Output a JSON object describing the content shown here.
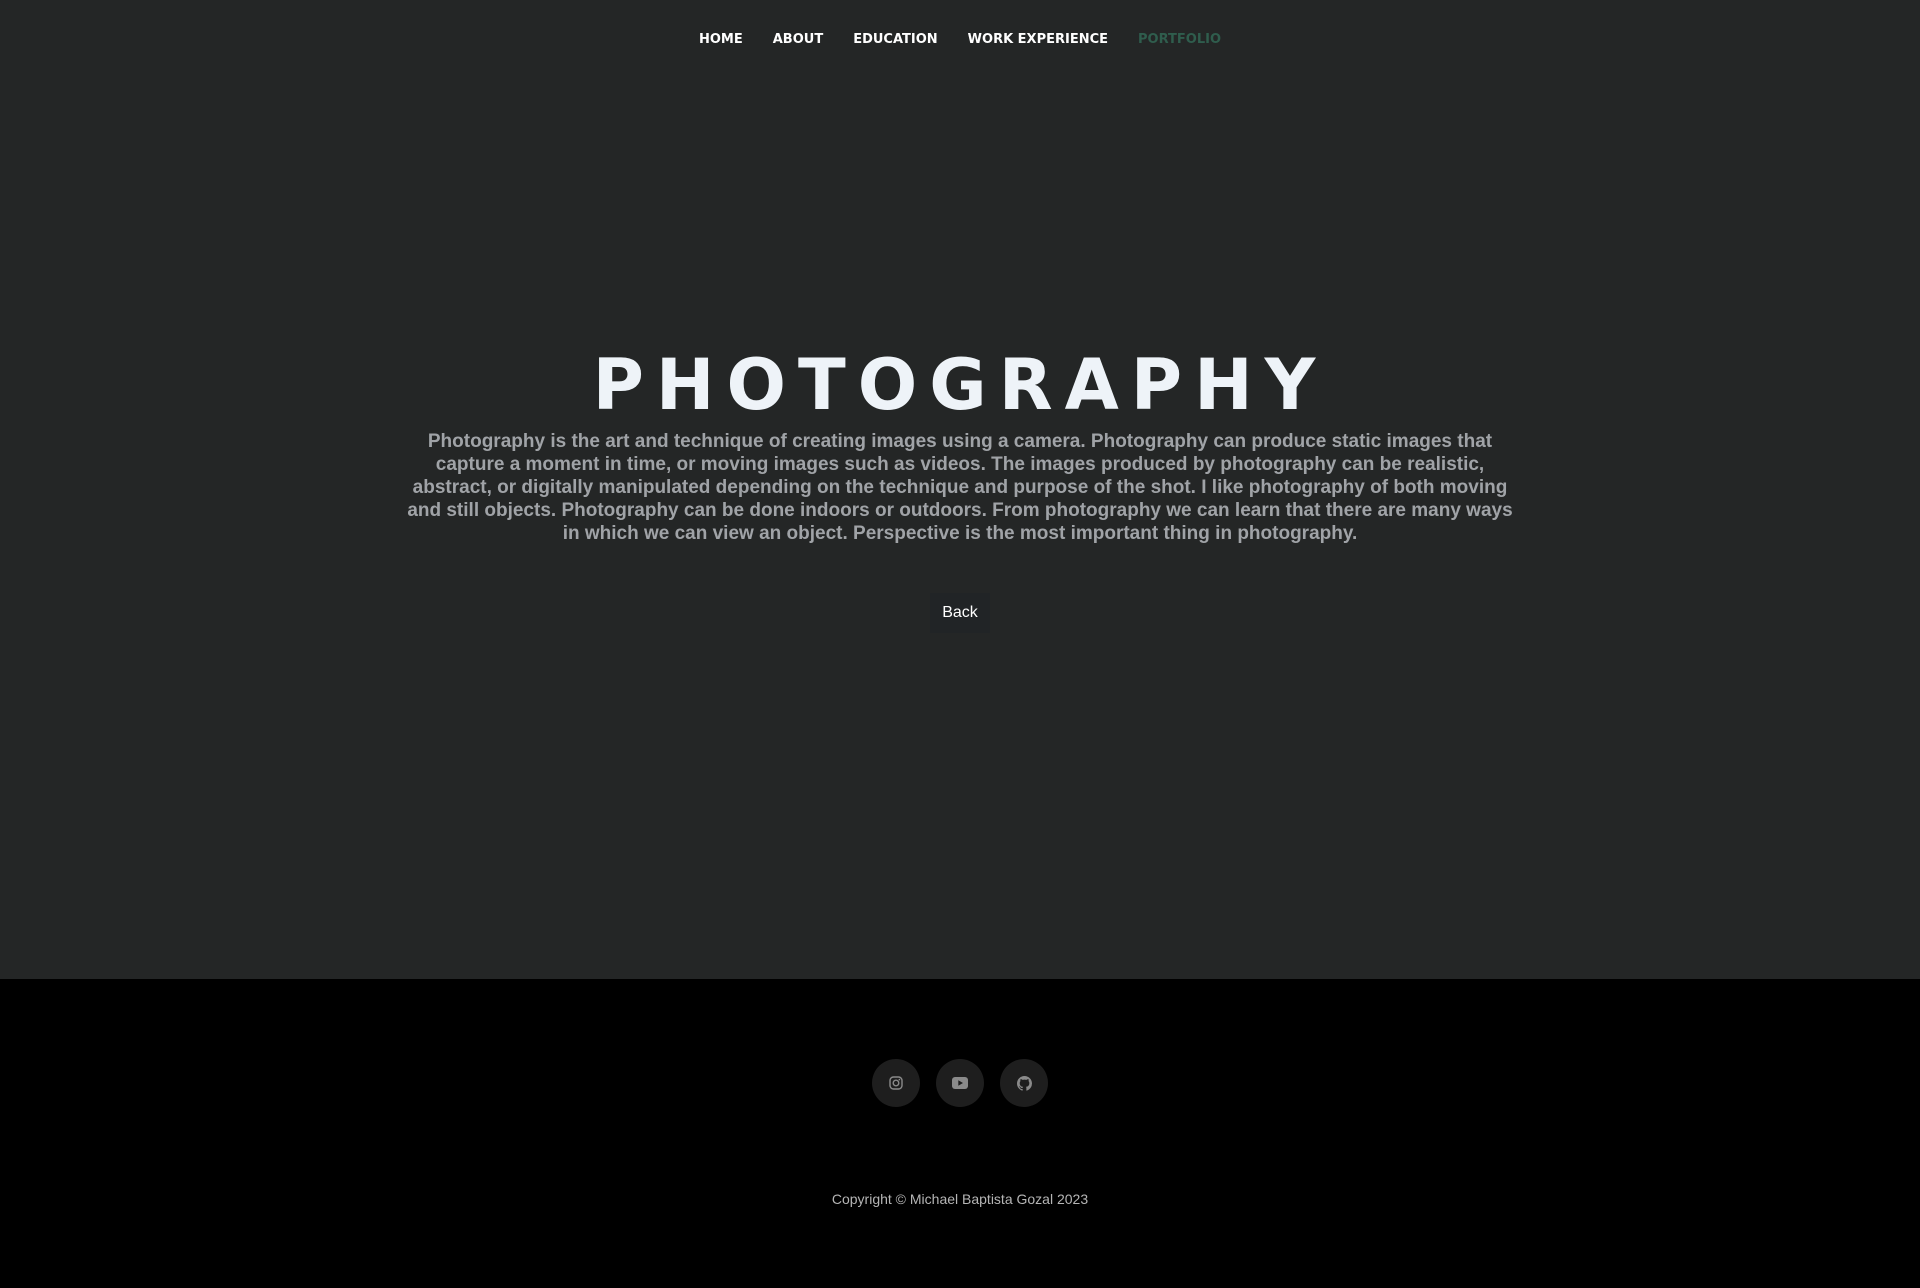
{
  "nav": {
    "items": [
      {
        "label": "HOME"
      },
      {
        "label": "ABOUT"
      },
      {
        "label": "EDUCATION"
      },
      {
        "label": "WORK EXPERIENCE"
      },
      {
        "label": "PORTFOLIO",
        "active": true
      }
    ]
  },
  "hero": {
    "title": "PHOTOGRAPHY",
    "description": "Photography is the art and technique of creating images using a camera. Photography can produce static images that capture a moment in time, or moving images such as videos. The images produced by photography can be realistic, abstract, or digitally manipulated depending on the technique and purpose of the shot. I like photography of both moving and still objects. Photography can be done indoors or outdoors. From photography we can learn that there are many ways in which we can view an object. Perspective is the most important thing in photography.",
    "back_label": "Back"
  },
  "footer": {
    "socials": [
      {
        "icon": "instagram-icon"
      },
      {
        "icon": "youtube-icon"
      },
      {
        "icon": "github-icon"
      }
    ],
    "copyright": "Copyright © Michael Baptista Gozal 2023"
  },
  "colors": {
    "main_background": "#242626",
    "footer_background": "#000000",
    "nav_text": "#ffffff",
    "nav_active": "#2f5d4d",
    "title_text": "#eef3f8",
    "body_text": "#a0a3a7"
  }
}
